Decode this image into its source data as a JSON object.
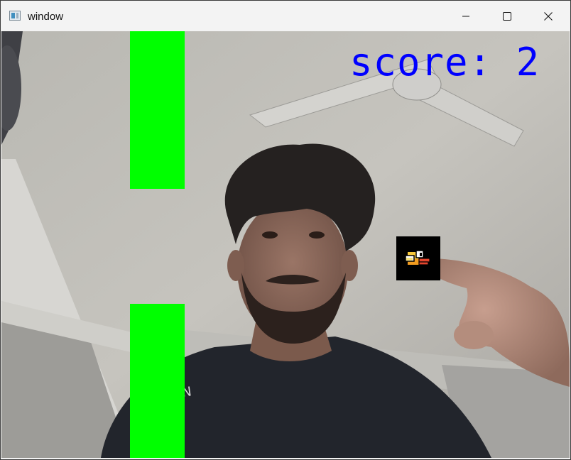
{
  "window": {
    "title": "window",
    "controls": {
      "minimize": "minimize",
      "maximize": "maximize",
      "close": "close"
    }
  },
  "game": {
    "score_text": "score: 2",
    "score_value": 2,
    "colors": {
      "pipe": "#00ff00",
      "score": "#0000ff",
      "bird_box": "#000000"
    },
    "sprites": {
      "player": "flappy-bird-icon"
    },
    "background": "webcam-feed"
  }
}
